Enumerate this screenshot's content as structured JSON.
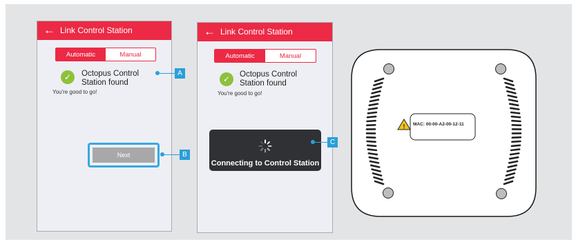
{
  "screen1": {
    "header_title": "Link Control Station",
    "tab_automatic": "Automatic",
    "tab_manual": "Manual",
    "found_line1": "Octopus Control",
    "found_line2": "Station found",
    "good_text": "You're good to go!",
    "next_label": "Next"
  },
  "screen2": {
    "header_title": "Link Control Station",
    "tab_automatic": "Automatic",
    "tab_manual": "Manual",
    "found_line1": "Octopus Control",
    "found_line2": "Station found",
    "good_text": "You're good to go!",
    "toast_text": "Connecting to Control Station"
  },
  "callouts": {
    "a": "A",
    "b": "B",
    "c": "C"
  },
  "device": {
    "mac_label": "MAC: 00-00-A2-00-12-11"
  },
  "colors": {
    "accent": "#ec2a45",
    "callout": "#2a9fd8",
    "check": "#8ec13b"
  },
  "icons": [
    "back-arrow-icon",
    "check-icon",
    "spinner-icon",
    "warning-icon"
  ]
}
